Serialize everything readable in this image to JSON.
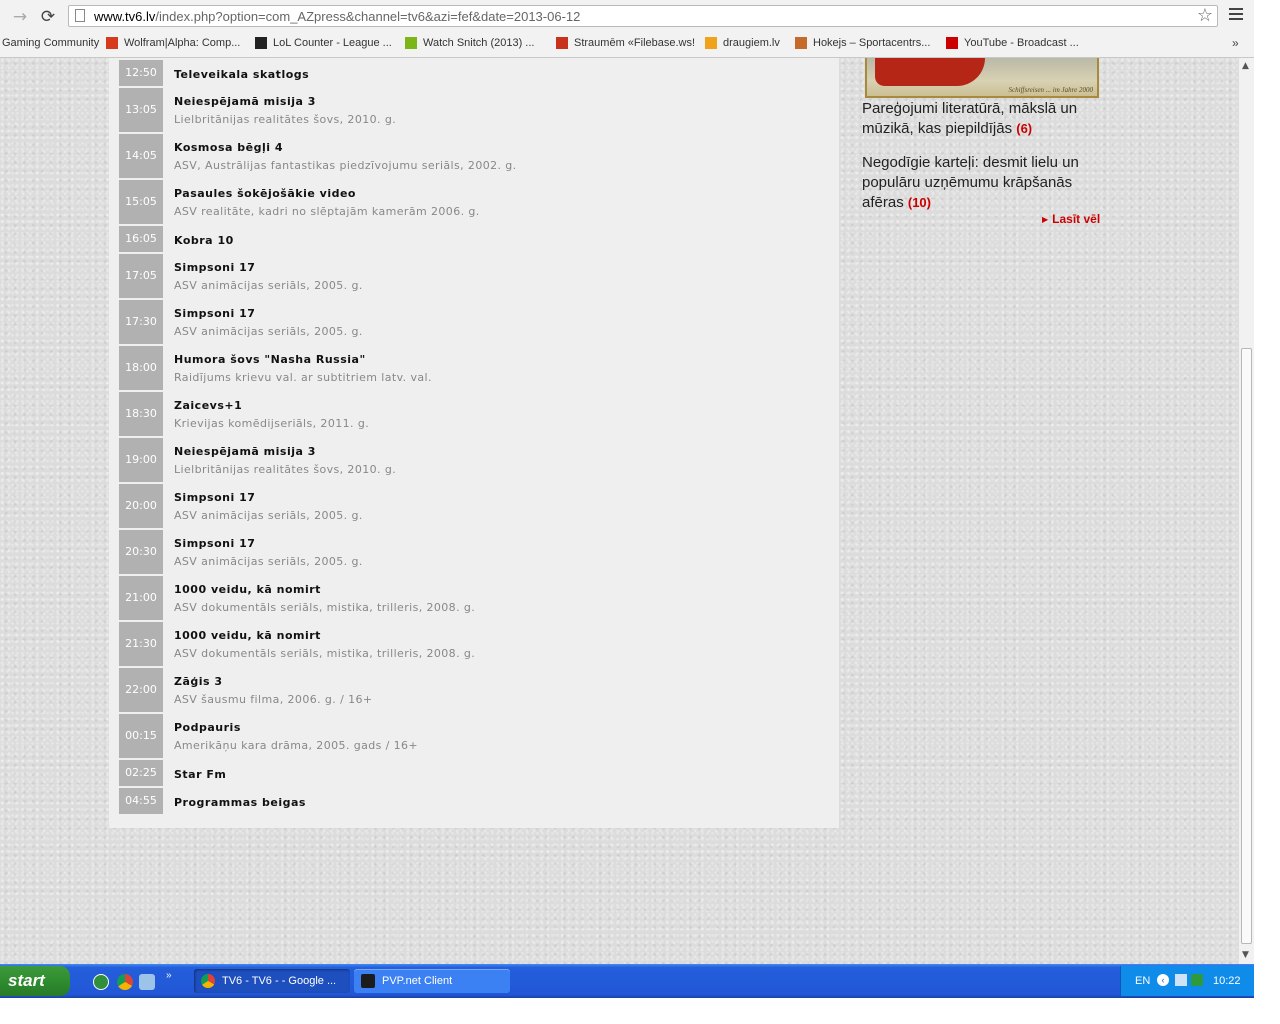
{
  "browser": {
    "url_host": "www.tv6.lv",
    "url_path": "/index.php?option=com_AZpress&channel=tv6&azi=fef&date=2013-06-12",
    "bookmarks": [
      {
        "label": "Gaming Community",
        "icon": "none",
        "color": ""
      },
      {
        "label": "Wolfram|Alpha: Comp...",
        "icon": "wolfram-icon",
        "color": "#d63a1a"
      },
      {
        "label": "LoL Counter - League ...",
        "icon": "lol-icon",
        "color": "#222222"
      },
      {
        "label": "Watch Snitch (2013) ...",
        "icon": "play-icon",
        "color": "#7bb518"
      },
      {
        "label": "Straumēm «Filebase.ws!",
        "icon": "filebase-icon",
        "color": "#c8311b"
      },
      {
        "label": "draugiem.lv",
        "icon": "draugiem-icon",
        "color": "#f0a31a"
      },
      {
        "label": "Hokejs – Sportacentrs...",
        "icon": "hockey-icon",
        "color": "#c66a2b"
      },
      {
        "label": "YouTube - Broadcast ...",
        "icon": "youtube-icon",
        "color": "#cc0000"
      }
    ],
    "more": "»"
  },
  "schedule": [
    {
      "time": "12:50",
      "title": "Televeikala skatlogs",
      "desc": ""
    },
    {
      "time": "13:05",
      "title": "Neiespējamā misija 3",
      "desc": "Lielbritānijas realitātes šovs, 2010. g."
    },
    {
      "time": "14:05",
      "title": "Kosmosa bēgļi 4",
      "desc": "ASV, Austrālijas fantastikas piedzīvojumu seriāls, 2002. g."
    },
    {
      "time": "15:05",
      "title": "Pasaules šokējošākie video",
      "desc": "ASV realitāte, kadri no slēptajām kamerām 2006. g."
    },
    {
      "time": "16:05",
      "title": "Kobra 10",
      "desc": ""
    },
    {
      "time": "17:05",
      "title": "Simpsoni 17",
      "desc": "ASV animācijas seriāls, 2005. g."
    },
    {
      "time": "17:30",
      "title": "Simpsoni 17",
      "desc": "ASV animācijas seriāls, 2005. g."
    },
    {
      "time": "18:00",
      "title": "Humora šovs \"Nasha Russia\"",
      "desc": "Raidījums krievu val. ar subtitriem latv. val."
    },
    {
      "time": "18:30",
      "title": "Zaicevs+1",
      "desc": "Krievijas komēdijseriāls, 2011. g."
    },
    {
      "time": "19:00",
      "title": "Neiespējamā misija 3",
      "desc": "Lielbritānijas realitātes šovs, 2010. g."
    },
    {
      "time": "20:00",
      "title": "Simpsoni 17",
      "desc": "ASV animācijas seriāls, 2005. g."
    },
    {
      "time": "20:30",
      "title": "Simpsoni 17",
      "desc": "ASV animācijas seriāls, 2005. g."
    },
    {
      "time": "21:00",
      "title": "1000 veidu, kā nomirt",
      "desc": "ASV dokumentāls seriāls, mistika, trilleris, 2008. g."
    },
    {
      "time": "21:30",
      "title": "1000 veidu, kā nomirt",
      "desc": "ASV dokumentāls seriāls, mistika, trilleris, 2008. g."
    },
    {
      "time": "22:00",
      "title": "Zāģis 3",
      "desc": "ASV šausmu filma, 2006. g. / 16+"
    },
    {
      "time": "00:15",
      "title": "Podpauris",
      "desc": "Amerikāņu kara drāma, 2005. gads / 16+"
    },
    {
      "time": "02:25",
      "title": "Star Fm",
      "desc": ""
    },
    {
      "time": "04:55",
      "title": "Programmas beigas",
      "desc": ""
    }
  ],
  "sidebar": {
    "image_caption": "Schiffsreisen ... im Jahre 2000",
    "link1": {
      "text": "Pareģojumi literatūrā, mākslā un mūzikā, kas piepildījās",
      "count": "(6)"
    },
    "link2": {
      "text": "Negodīgie karteļi: desmit lielu un populāru uzņēmumu krāpšanās afēras",
      "count": "(10)"
    },
    "read_more": "Lasīt vēl"
  },
  "taskbar": {
    "start": "start",
    "tasks": [
      {
        "label": "TV6 - TV6 - - Google ...",
        "active": true
      },
      {
        "label": "PVP.net Client",
        "active": false
      }
    ],
    "lang": "EN",
    "clock": "10:22",
    "more": "»"
  }
}
